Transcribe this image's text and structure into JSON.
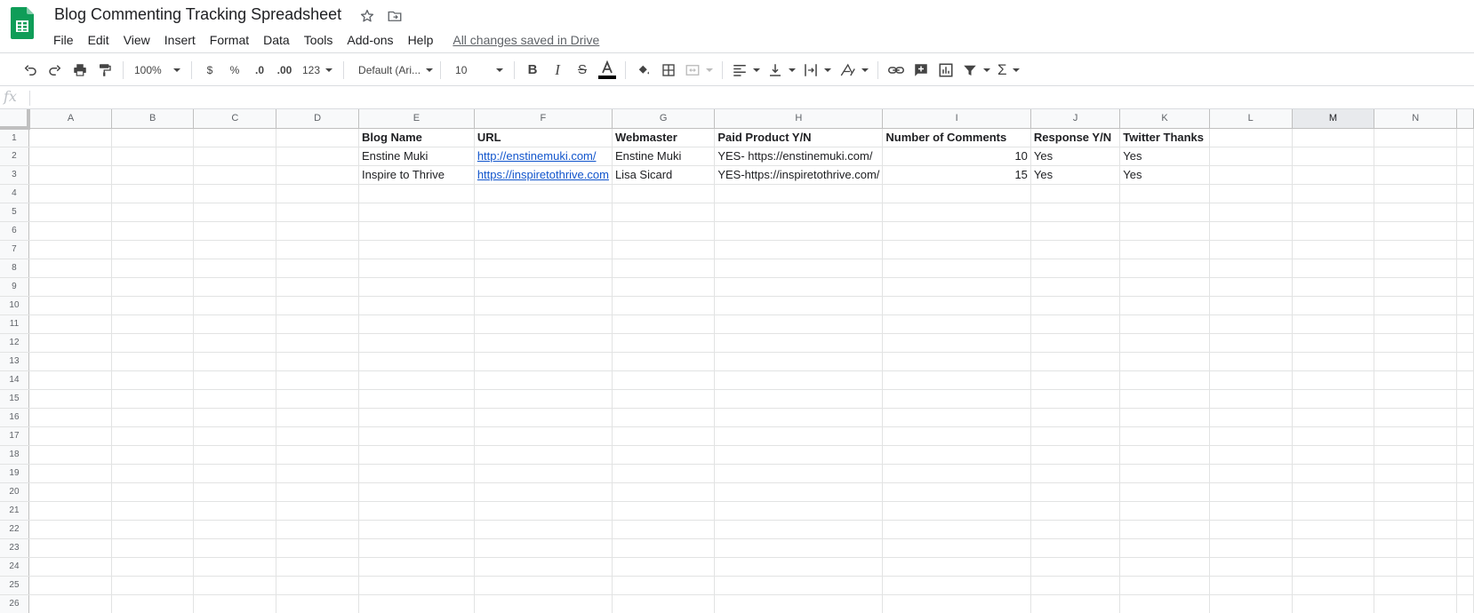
{
  "app": {
    "icon": "sheets-logo-icon"
  },
  "document": {
    "title": "Blog Commenting Tracking Spreadsheet",
    "star_icon": "star-icon",
    "move_icon": "move-to-folder-icon"
  },
  "menu": {
    "items": [
      "File",
      "Edit",
      "View",
      "Insert",
      "Format",
      "Data",
      "Tools",
      "Add-ons",
      "Help"
    ],
    "saved_status": "All changes saved in Drive"
  },
  "toolbar": {
    "zoom": "100%",
    "currency": "$",
    "percent": "%",
    "decrease_decimals": ".0",
    "increase_decimals": ".00",
    "more_formats": "123",
    "font_family": "Default (Ari...",
    "font_size": "10",
    "text_color": "#000000"
  },
  "formula_bar": {
    "fx": "fx",
    "value": ""
  },
  "sheet": {
    "columns": [
      "A",
      "B",
      "C",
      "D",
      "E",
      "F",
      "G",
      "H",
      "I",
      "J",
      "K",
      "L",
      "M",
      "N"
    ],
    "selected_column": "M",
    "row_count": 26,
    "header_row": [
      "Blog Name",
      "URL",
      "Webmaster",
      "Paid Product Y/N",
      "Number of Comments",
      "Response Y/N",
      "Twitter Thanks"
    ],
    "rows": [
      {
        "blog_name": "Enstine Muki",
        "url": "http://enstinemuki.com/",
        "webmaster": "Enstine Muki",
        "paid_product": "YES- https://enstinemuki.com/",
        "comments": "10",
        "response": "Yes",
        "twitter_thanks": "Yes"
      },
      {
        "blog_name": "Inspire to Thrive",
        "url": "https://inspiretothrive.com",
        "webmaster": "Lisa Sicard",
        "paid_product": "YES-https://inspiretothrive.com/",
        "comments": "15",
        "response": "Yes",
        "twitter_thanks": "Yes"
      }
    ]
  },
  "colors": {
    "brand_green": "#0f9d58",
    "link_blue": "#1155cc",
    "grid_line": "#e2e3e3"
  }
}
